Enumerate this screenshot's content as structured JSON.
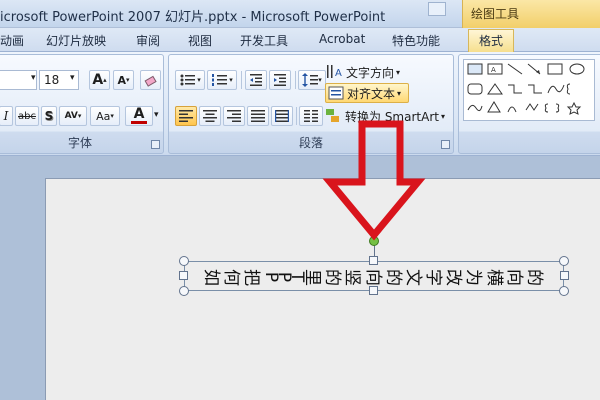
{
  "window": {
    "title": "icrosoft PowerPoint 2007 幻灯片.pptx - Microsoft PowerPoint",
    "context_tab": "绘图工具"
  },
  "tabs": [
    {
      "label": "动画"
    },
    {
      "label": "幻灯片放映"
    },
    {
      "label": "审阅"
    },
    {
      "label": "视图"
    },
    {
      "label": "开发工具"
    },
    {
      "label": "Acrobat"
    },
    {
      "label": "特色功能"
    },
    {
      "label": "格式"
    }
  ],
  "font_group": {
    "label": "字体",
    "font_size": "18",
    "grow_label": "A",
    "shrink_label": "A",
    "italic_label": "I",
    "strike_label": "abc",
    "shadow_label": "S",
    "spacing_label": "AV",
    "case_label": "Aa",
    "color_label": "A",
    "font_color": "#c00000"
  },
  "paragraph_group": {
    "label": "段落",
    "text_direction_label": "文字方向",
    "align_text_label": "对齐文本",
    "convert_smartart_label": "转换为 SmartArt"
  },
  "slide": {
    "textbox_text": [
      "如",
      "何",
      "把",
      "P",
      "P",
      "T",
      "里",
      "的",
      "竖",
      "向",
      "的",
      "文",
      "字",
      "改",
      "为",
      "横",
      "向",
      "的"
    ]
  },
  "colors": {
    "accent": "#ffc54d",
    "arrow": "#d9141c"
  }
}
